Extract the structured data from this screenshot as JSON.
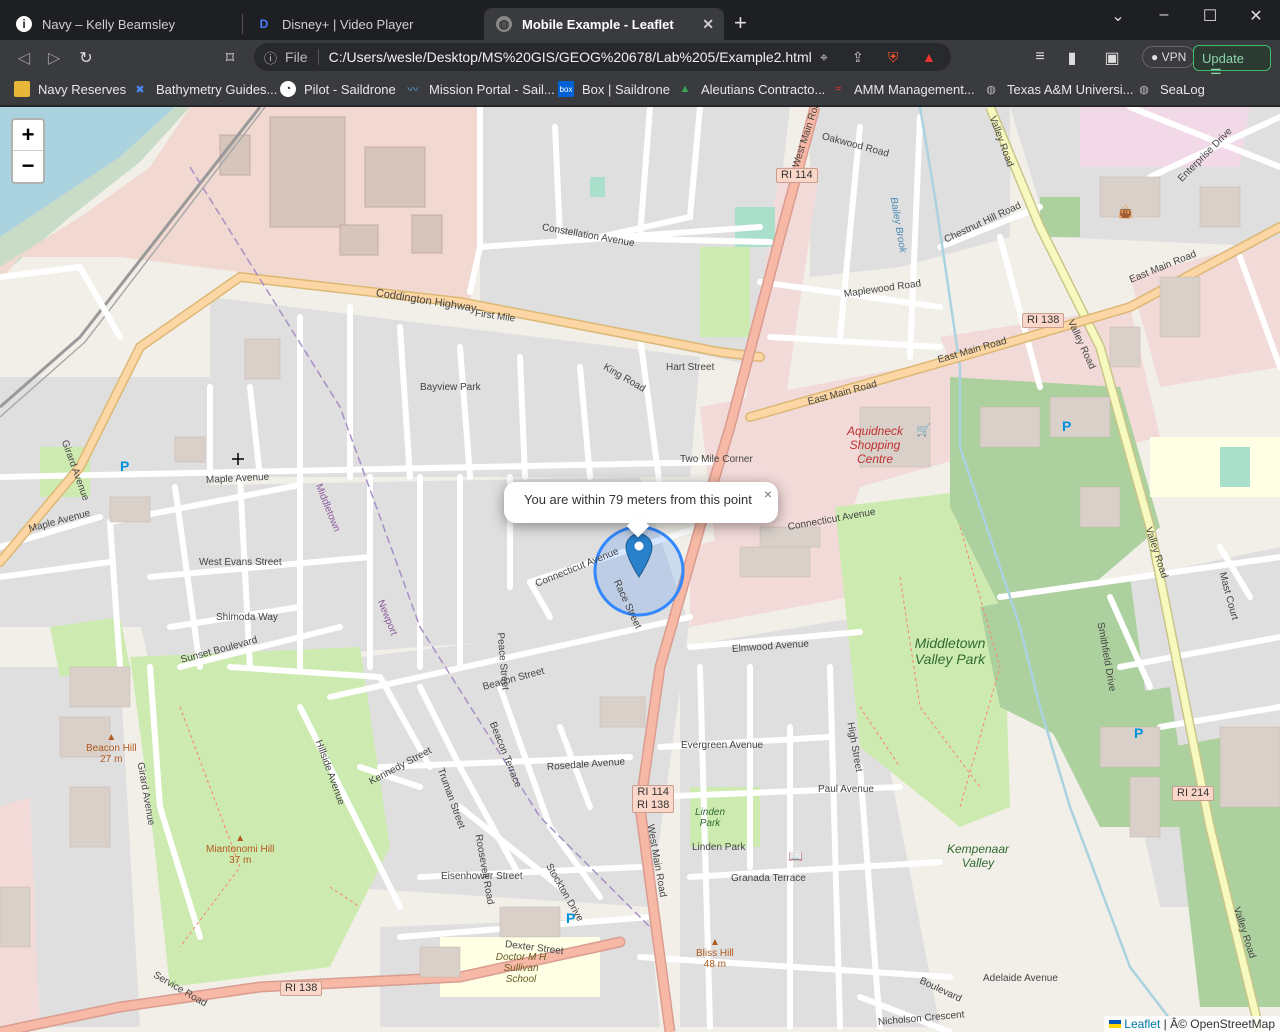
{
  "tabs": [
    {
      "title": "Navy – Kelly Beamsley",
      "icon": "info-icon"
    },
    {
      "title": "Disney+ | Video Player",
      "icon": "disney-icon"
    },
    {
      "title": "Mobile Example - Leaflet",
      "icon": "globe-icon",
      "active": true
    }
  ],
  "toolbar": {
    "scheme": "File",
    "url": "C:/Users/wesle/Desktop/MS%20GIS/GEOG%20678/Lab%205/Example2.html",
    "vpn": "VPN",
    "update": "Update"
  },
  "bookmarks": [
    {
      "label": "Navy Reserves",
      "icon": "folder-icon"
    },
    {
      "label": "Bathymetry Guides...",
      "icon": "tool-icon"
    },
    {
      "label": "Pilot - Saildrone",
      "icon": "compass-icon"
    },
    {
      "label": "Mission Portal - Sail...",
      "icon": "chart-icon"
    },
    {
      "label": "Box | Saildrone",
      "icon": "box-icon"
    },
    {
      "label": "Aleutians Contracto...",
      "icon": "drive-icon"
    },
    {
      "label": "AMM Management...",
      "icon": "amm-icon"
    },
    {
      "label": "Texas A&M Universi...",
      "icon": "globe-icon"
    },
    {
      "label": "SeaLog",
      "icon": "globe-icon"
    }
  ],
  "map": {
    "zoom_in": "+",
    "zoom_out": "−",
    "popup_text": "You are within 79 meters from this point",
    "popup_close": "×",
    "attribution_leaflet": "Leaflet",
    "attribution_rest": " | Â© OpenStreetMap",
    "labels": {
      "coddington": "Coddington Highway",
      "first_mile": "First Mile",
      "east_main_1": "East Main Road",
      "east_main_2": "East Main Road",
      "east_main_3": "East Main Road",
      "west_main_top": "West Main Road",
      "west_main_bottom": "West Main Road",
      "valley_road_1": "Valley Road",
      "valley_road_2": "Valley Road",
      "valley_road_3": "Valley Road",
      "valley_road_4": "Valley Road",
      "maple_ave_1": "Maple Avenue",
      "maple_ave_2": "Maple Avenue",
      "connecticut_1": "Connecticut Avenue",
      "connecticut_2": "Connecticut Avenue",
      "two_mile": "Two Mile Corner",
      "beacon_st": "Beacon Street",
      "beacon_terrace": "Beacon Terrace",
      "elmwood": "Elmwood Avenue",
      "evergreen": "Evergreen Avenue",
      "paul": "Paul Avenue",
      "rosedale": "Rosedale Avenue",
      "eisenhower": "Eisenhower Street",
      "dexter": "Dexter Street",
      "kennedy": "Kennedy Street",
      "truman": "Truman Street",
      "linden_park": "Linden Park",
      "linden_park_st": "Linden Park",
      "granada": "Granada Terrace",
      "middletown_park": "Middletown Valley Park",
      "kempenaar": "Kempenaar Valley",
      "aquidneck": "Aquidneck Shopping Centre",
      "beacon_hill": "Beacon Hill",
      "beacon_hill_ele": "27 m",
      "miantonomi": "Miantonomi Hill",
      "miantonomi_ele": "37 m",
      "bliss_hill": "Bliss Hill",
      "bliss_hill_ele": "48 m",
      "sullivan": "Doctor M H Sullivan School",
      "oakwood": "Oakwood Road",
      "maplewood": "Maplewood Road",
      "king": "King Road",
      "hart": "Hart Street",
      "bayview": "Bayview Park",
      "constellation": "Constellation Avenue",
      "chestnut": "Chestnut Hill Road",
      "enterprise": "Enterprise Drive",
      "adelaide": "Adelaide Avenue",
      "nicholson": "Nicholson Crescent",
      "boulevard": "Boulevard",
      "service_road": "Service Road",
      "sunset": "Sunset Boulevard",
      "shimoda": "Shimoda Way",
      "west_evans": "West Evans Street",
      "girard_1": "Girard Avenue",
      "girard_2": "Girard Avenue",
      "high_street": "High Street",
      "middletown_boundary": "Middletown",
      "newport_boundary": "Newport",
      "race_street": "Race Street",
      "peace_street": "Peace Street",
      "smithfield": "Smithfield Drive",
      "mast_court": "Mast Court",
      "hillside": "Hillside Avenue",
      "stockton": "Stockton Drive",
      "roosevelt": "Roosevelt Road",
      "bailey_brook": "Bailey Brook"
    },
    "shields": {
      "ri114_top": "RI 114",
      "ri138_right": "RI 138",
      "ri114_mid": "RI 114",
      "ri138_mid": "RI 138",
      "ri214": "RI 214",
      "ri138_bottom": "RI 138"
    }
  }
}
